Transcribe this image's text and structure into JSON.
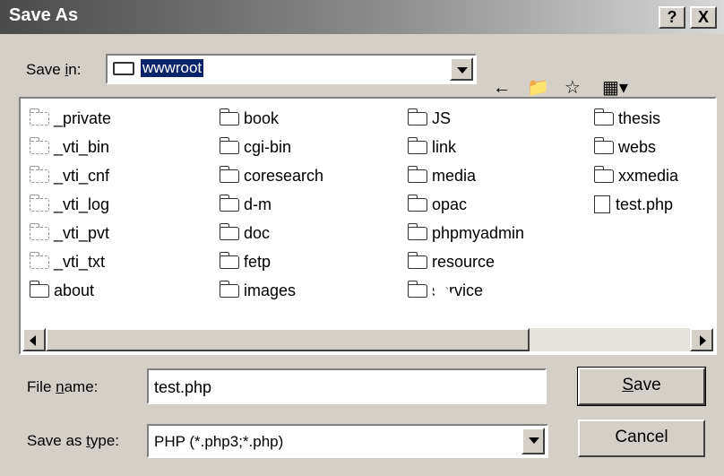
{
  "window": {
    "title": "Save As",
    "help_label": "?",
    "close_label": "X"
  },
  "save_in": {
    "label_pre": "Save ",
    "label_u": "i",
    "label_post": "n:",
    "value": "wwwroot"
  },
  "files": [
    {
      "name": "_private",
      "kind": "folder-hidden"
    },
    {
      "name": "_vti_bin",
      "kind": "folder-hidden"
    },
    {
      "name": "_vti_cnf",
      "kind": "folder-hidden"
    },
    {
      "name": "_vti_log",
      "kind": "folder-hidden"
    },
    {
      "name": "_vti_pvt",
      "kind": "folder-hidden"
    },
    {
      "name": "_vti_txt",
      "kind": "folder-hidden"
    },
    {
      "name": "about",
      "kind": "folder"
    },
    {
      "name": "book",
      "kind": "folder"
    },
    {
      "name": "cgi-bin",
      "kind": "folder"
    },
    {
      "name": "coresearch",
      "kind": "folder"
    },
    {
      "name": "d-m",
      "kind": "folder"
    },
    {
      "name": "doc",
      "kind": "folder"
    },
    {
      "name": "fetp",
      "kind": "folder"
    },
    {
      "name": "images",
      "kind": "folder"
    },
    {
      "name": "JS",
      "kind": "folder"
    },
    {
      "name": "link",
      "kind": "folder"
    },
    {
      "name": "media",
      "kind": "folder"
    },
    {
      "name": "opac",
      "kind": "folder"
    },
    {
      "name": "phpmyadmin",
      "kind": "folder"
    },
    {
      "name": "resource",
      "kind": "folder"
    },
    {
      "name": "service",
      "kind": "folder"
    },
    {
      "name": "thesis",
      "kind": "folder"
    },
    {
      "name": "webs",
      "kind": "folder"
    },
    {
      "name": "xxmedia",
      "kind": "folder"
    },
    {
      "name": "test.php",
      "kind": "php-file"
    }
  ],
  "filename": {
    "label_pre": "File ",
    "label_u": "n",
    "label_post": "ame:",
    "value": "test.php"
  },
  "savetype": {
    "label_pre": "Save as ",
    "label_u": "t",
    "label_post": "ype:",
    "value": "PHP (*.php3;*.php)"
  },
  "buttons": {
    "save_u": "S",
    "save_post": "ave",
    "cancel": "Cancel"
  },
  "icons": {
    "back": "back-arrow-icon",
    "up": "up-one-level-icon",
    "new_folder": "new-folder-icon",
    "view": "view-menu-icon"
  }
}
